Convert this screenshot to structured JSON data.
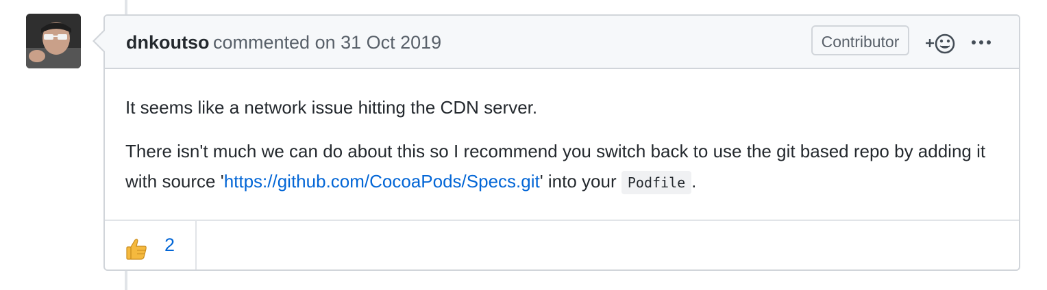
{
  "comment": {
    "author": "dnkoutso",
    "meta_text": "commented on 31 Oct 2019",
    "badge": "Contributor",
    "body": {
      "paragraph1": "It seems like a network issue hitting the CDN server.",
      "paragraph2_part1": "There isn't much we can do about this so I recommend you switch back to use the git based repo by adding it with source '",
      "link_text": "https://github.com/CocoaPods/Specs.git",
      "paragraph2_part2": "' into your ",
      "code_text": "Podfile",
      "paragraph2_part3": "."
    },
    "reactions": [
      {
        "icon": "thumbs-up-icon",
        "count": "2"
      }
    ]
  },
  "colors": {
    "link": "#0366d6",
    "border": "#d1d5da",
    "header_bg": "#f6f8fa",
    "text": "#24292e",
    "muted": "#586069"
  }
}
